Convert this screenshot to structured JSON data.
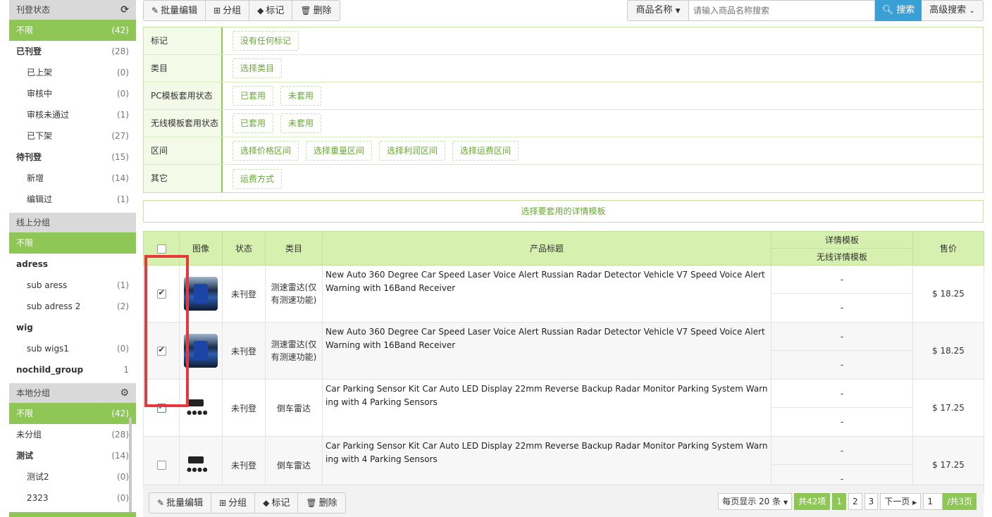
{
  "sidebar": {
    "publish_status": {
      "title": "刊登状态",
      "items": [
        {
          "label": "不限",
          "count": "(42)"
        },
        {
          "label": "已刊登",
          "count": "(28)"
        },
        {
          "label": "已上架",
          "count": "(0)"
        },
        {
          "label": "审核中",
          "count": "(0)"
        },
        {
          "label": "审核未通过",
          "count": "(1)"
        },
        {
          "label": "已下架",
          "count": "(27)"
        },
        {
          "label": "待刊登",
          "count": "(15)"
        },
        {
          "label": "新增",
          "count": "(14)"
        },
        {
          "label": "编辑过",
          "count": "(1)"
        }
      ]
    },
    "online_group": {
      "title": "线上分组",
      "items": [
        {
          "label": "不限",
          "count": ""
        },
        {
          "label": "adress",
          "count": ""
        },
        {
          "label": "sub aress",
          "count": "(1)"
        },
        {
          "label": "sub adress 2",
          "count": "(2)"
        },
        {
          "label": "wig",
          "count": ""
        },
        {
          "label": "sub wigs1",
          "count": "(0)"
        },
        {
          "label": "nochild_group",
          "count": "1"
        }
      ]
    },
    "local_group": {
      "title": "本地分组",
      "items": [
        {
          "label": "不限",
          "count": "(42)"
        },
        {
          "label": "未分组",
          "count": "(28)"
        },
        {
          "label": "测试",
          "count": "(14)"
        },
        {
          "label": "测试2",
          "count": "(0)"
        },
        {
          "label": "2323",
          "count": "(0)"
        }
      ]
    }
  },
  "toolbar": {
    "batch_edit": "批量编辑",
    "group": "分组",
    "mark": "标记",
    "delete": "删除"
  },
  "search": {
    "field_select": "商品名称",
    "placeholder": "请输入商品名称搜索",
    "search_btn": "搜索",
    "advanced": "高级搜索"
  },
  "filters": {
    "mark": {
      "label": "标记",
      "options": [
        "没有任何标记"
      ]
    },
    "category": {
      "label": "类目",
      "options": [
        "选择类目"
      ]
    },
    "pc_template": {
      "label": "PC模板套用状态",
      "options": [
        "已套用",
        "未套用"
      ]
    },
    "mobile_template": {
      "label": "无线模板套用状态",
      "options": [
        "已套用",
        "未套用"
      ]
    },
    "range": {
      "label": "区间",
      "options": [
        "选择价格区间",
        "选择重量区间",
        "选择利润区间",
        "选择运费区间"
      ]
    },
    "other": {
      "label": "其它",
      "options": [
        "运费方式"
      ]
    }
  },
  "template_bar": "选择要套用的详情模板",
  "table": {
    "headers": {
      "image": "图像",
      "status": "状态",
      "category": "类目",
      "title": "产品标题",
      "detail_template": "详情模板",
      "mobile_template": "无线详情模板",
      "price": "售价"
    },
    "rows": [
      {
        "status": "未刊登",
        "category": "测速雷达(仅有测速功能)",
        "title": "New Auto 360 Degree Car Speed Laser Voice Alert Russian Radar Detector Vehicle V7 Speed Voice Alert Warning with 16Band Receiver",
        "tpl1": "-",
        "tpl2": "-",
        "price": "$ 18.25"
      },
      {
        "status": "未刊登",
        "category": "测速雷达(仅有测速功能)",
        "title": "New Auto 360 Degree Car Speed Laser Voice Alert Russian Radar Detector Vehicle V7 Speed Voice Alert Warning with 16Band Receiver",
        "tpl1": "-",
        "tpl2": "-",
        "price": "$ 18.25"
      },
      {
        "status": "未刊登",
        "category": "倒车雷达",
        "title": "Car Parking Sensor Kit Car Auto LED Display 22mm Reverse Backup Radar Monitor Parking System Warning with 4 Parking Sensors",
        "tpl1": "-",
        "tpl2": "-",
        "price": "$ 17.25"
      },
      {
        "status": "未刊登",
        "category": "倒车雷达",
        "title": "Car Parking Sensor Kit Car Auto LED Display 22mm Reverse Backup Radar Monitor Parking System Warning with 4 Parking Sensors",
        "tpl1": "-",
        "tpl2": "-",
        "price": "$ 17.25"
      }
    ]
  },
  "pager": {
    "per_page": "每页显示 20 条",
    "total": "共42项",
    "pages": [
      "1",
      "2",
      "3"
    ],
    "next": "下一页",
    "current": "1",
    "total_pages": "/共3页"
  },
  "colors": {
    "accent": "#8fc757",
    "search": "#3a9fd5",
    "highlight": "#e8383d"
  }
}
